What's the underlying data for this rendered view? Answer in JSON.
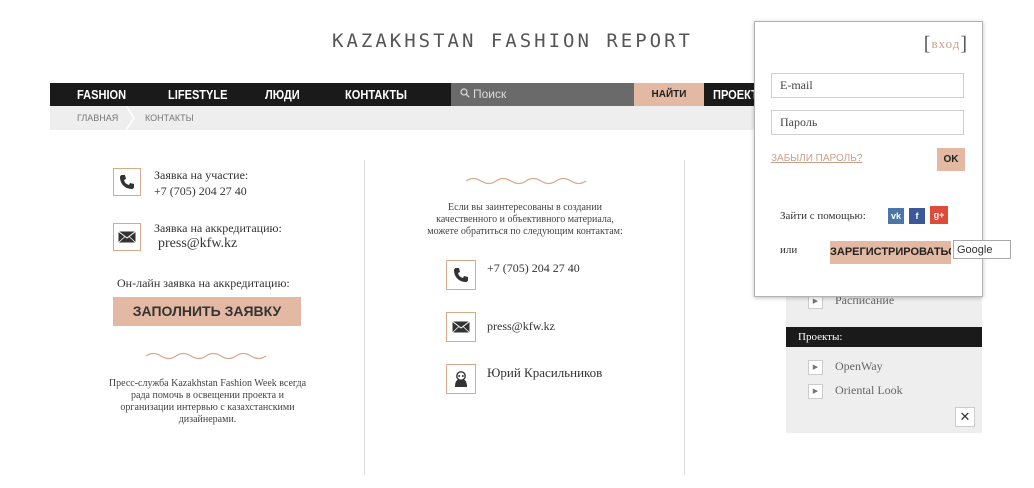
{
  "site": {
    "logo": "KAZAKHSTAN FASHION REPORT"
  },
  "nav": {
    "items": [
      "FASHION",
      "LIFESTYLE",
      "ЛЮДИ",
      "КОНТАКТЫ"
    ],
    "search_placeholder": "Поиск",
    "search_button": "НАЙТИ",
    "projects_partial": "ПРОЕКТ"
  },
  "breadcrumb": [
    "ГЛАВНАЯ",
    "КОНТАКТЫ"
  ],
  "left": {
    "application_label": "Заявка на участие:",
    "application_phone": "+7 (705) 204 27 40",
    "accreditation_label": "Заявка на аккредитацию:",
    "accreditation_email": "press@kfw.kz",
    "online_label": "Он-лайн заявка на аккредитацию:",
    "fill_button": "ЗАПОЛНИТЬ ЗАЯВКУ",
    "press_text": [
      "Пресс-служба Kazakhstan Fashion Week всегда",
      "рада помочь в освещении проекта и",
      "организации интервью с казахстанскими",
      "дизайнерами."
    ]
  },
  "middle": {
    "intro": [
      "Если вы заинтересованы в создании",
      "качественного и объективного материала,",
      "можете обратиться по следующим контактам:"
    ],
    "phone": "+7 (705) 204 27 40",
    "email": "press@kfw.kz",
    "person": "Юрий Красильников"
  },
  "sidebar": {
    "schedule": "Расписание",
    "projects_header": "Проекты:",
    "projects": [
      "OpenWay",
      "Oriental Look"
    ],
    "close": "✕"
  },
  "login": {
    "title": "вход",
    "email_placeholder": "E-mail",
    "password_placeholder": "Пароль",
    "forgot": "ЗАБЫЛИ ПАРОЛЬ?",
    "ok": "OK",
    "social_label": "Зайти с помощью:",
    "social": {
      "vk": "vk",
      "fb": "f",
      "gplus": "g+"
    },
    "or": "или",
    "register": "ЗАРЕГИСТРИРОВАТЬСЯ"
  },
  "tooltip": "Google",
  "colors": {
    "accent": "#e4b9a3",
    "nav": "#1a1a1a",
    "vk": "#4a76a8",
    "facebook": "#3b5998",
    "gplus": "#dd4b39"
  },
  "icons": [
    "phone-icon",
    "mail-icon",
    "person-icon",
    "search-icon",
    "wave-divider-icon",
    "arrow-right-icon",
    "close-icon"
  ]
}
